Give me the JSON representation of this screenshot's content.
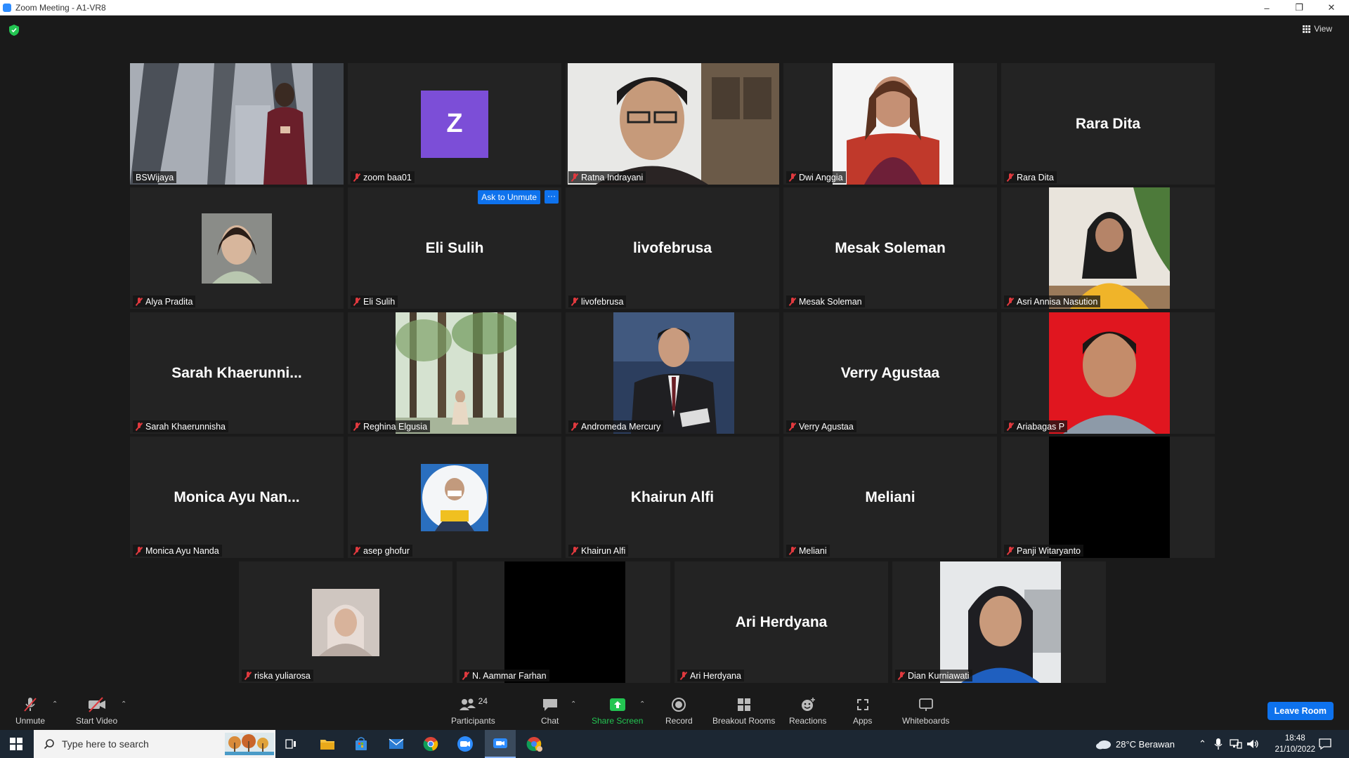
{
  "window": {
    "title": "Zoom Meeting - A1-VR8"
  },
  "top": {
    "view_label": "View"
  },
  "tiles": [
    {
      "label": "BSWijaya",
      "big": ""
    },
    {
      "label": "zoom baa01",
      "big": "",
      "initial": "Z"
    },
    {
      "label": "Ratna Indrayani",
      "big": ""
    },
    {
      "label": "Dwi Anggia",
      "big": ""
    },
    {
      "label": "Rara Dita",
      "big": "Rara Dita"
    },
    {
      "label": "Alya Pradita",
      "big": ""
    },
    {
      "label": "Eli Sulih",
      "big": "Eli Sulih"
    },
    {
      "label": "livofebrusa",
      "big": "livofebrusa"
    },
    {
      "label": "Mesak Soleman",
      "big": "Mesak Soleman"
    },
    {
      "label": "Asri Annisa Nasution",
      "big": ""
    },
    {
      "label": "Sarah Khaerunnisha",
      "big": "Sarah  Khaerunni..."
    },
    {
      "label": "Reghina Elgusia",
      "big": ""
    },
    {
      "label": "Andromeda Mercury",
      "big": ""
    },
    {
      "label": "Verry Agustaa",
      "big": "Verry Agustaa"
    },
    {
      "label": "Ariabagas P",
      "big": ""
    },
    {
      "label": "Monica Ayu Nanda",
      "big": "Monica  Ayu  Nan..."
    },
    {
      "label": "asep ghofur",
      "big": ""
    },
    {
      "label": "Khairun Alfi",
      "big": "Khairun Alfi"
    },
    {
      "label": "Meliani",
      "big": "Meliani"
    },
    {
      "label": "Panji Witaryanto",
      "big": ""
    },
    {
      "label": "riska yuliarosa",
      "big": ""
    },
    {
      "label": "N. Aammar Farhan",
      "big": ""
    },
    {
      "label": "Ari Herdyana",
      "big": "Ari Herdyana"
    },
    {
      "label": "Dian Kurniawati",
      "big": ""
    }
  ],
  "hover": {
    "ask_unmute": "Ask to Unmute",
    "more": "···"
  },
  "toolbar": {
    "unmute": "Unmute",
    "start_video": "Start Video",
    "participants": "Participants",
    "participants_count": "24",
    "chat": "Chat",
    "share_screen": "Share Screen",
    "record": "Record",
    "breakout_rooms": "Breakout Rooms",
    "reactions": "Reactions",
    "apps": "Apps",
    "whiteboards": "Whiteboards",
    "leave": "Leave Room"
  },
  "taskbar": {
    "search_placeholder": "Type here to search",
    "weather": "28°C  Berawan",
    "time": "18:48",
    "date": "21/10/2022"
  },
  "colors": {
    "accent": "#0e72ed",
    "active_speaker": "#c8e64b",
    "share_green": "#23c552",
    "muted_red": "#e0393e"
  }
}
